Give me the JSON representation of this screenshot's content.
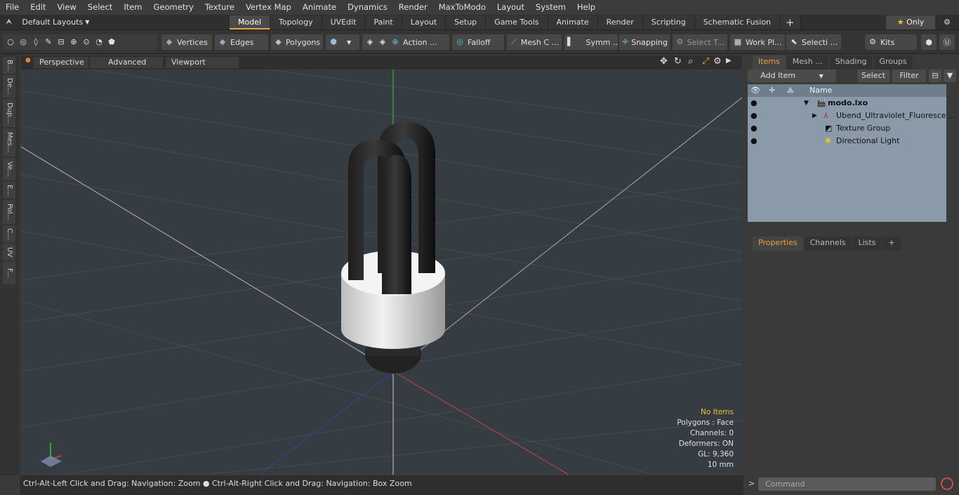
{
  "menu": [
    "File",
    "Edit",
    "View",
    "Select",
    "Item",
    "Geometry",
    "Texture",
    "Vertex Map",
    "Animate",
    "Dynamics",
    "Render",
    "MaxToModo",
    "Layout",
    "System",
    "Help"
  ],
  "layout_selector": "Default Layouts",
  "mode_tabs": [
    "Model",
    "Topology",
    "UVEdit",
    "Paint",
    "Layout",
    "Setup",
    "Game Tools",
    "Animate",
    "Render",
    "Scripting",
    "Schematic Fusion"
  ],
  "only_label": "Only",
  "toolbar": {
    "vertices": "Vertices",
    "edges": "Edges",
    "polygons": "Polygons",
    "action": "Action ...",
    "falloff": "Falloff",
    "mesh": "Mesh C ...",
    "symm": "Symm ...",
    "snapping": "Snapping",
    "select_t": "Select T...",
    "work_pl": "Work Pl...",
    "selecti": "Selecti ...",
    "kits": "Kits"
  },
  "left_tabs": [
    "B...",
    "De...",
    "Dup...",
    "Mes...",
    "Ve...",
    "E...",
    "Pol...",
    "C...",
    "UV",
    "F..."
  ],
  "viewport": {
    "perspective": "Perspective",
    "advanced": "Advanced",
    "viewport_textures": "Viewport Textures",
    "stats": {
      "items": "No Items",
      "polygons": "Polygons : Face",
      "channels": "Channels: 0",
      "deformers": "Deformers: ON",
      "gl": "GL: 9,360",
      "scale": "10 mm"
    }
  },
  "status_text": "Ctrl-Alt-Left Click and Drag: Navigation: Zoom ● Ctrl-Alt-Right Click and Drag: Navigation: Box Zoom",
  "items_panel": {
    "tabs": [
      "Items",
      "Mesh ...",
      "Shading",
      "Groups"
    ],
    "add_item": "Add Item",
    "select": "Select",
    "filter": "Filter",
    "name_header": "Name",
    "rows": [
      "modo.lxo",
      "Ubend_Ultraviolet_Fluoresce ...",
      "Texture Group",
      "Directional Light"
    ]
  },
  "props_panel": {
    "tabs": [
      "Properties",
      "Channels",
      "Lists"
    ]
  },
  "command_placeholder": "Command"
}
